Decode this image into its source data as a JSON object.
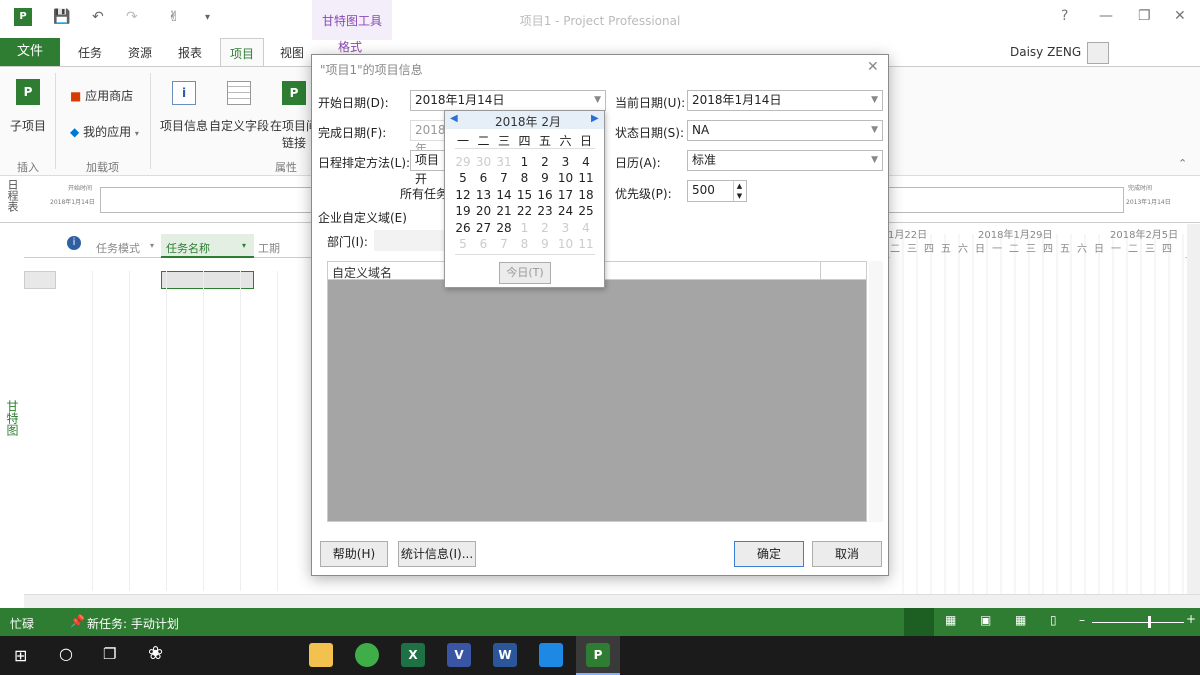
{
  "window": {
    "app_title": "项目1 - Project Professional",
    "contextual_tab": "甘特图工具",
    "contextual_subtab": "格式",
    "user_name": "Daisy ZENG",
    "help": "?"
  },
  "ribbon": {
    "file_tab": "文件",
    "tabs": [
      "任务",
      "资源",
      "报表",
      "项目",
      "视图"
    ],
    "active_tab": "项目",
    "buttons": {
      "subproject": "子项目",
      "app_store": "应用商店",
      "my_apps": "我的应用",
      "project_info": "项目信息",
      "custom_fields": "自定义字段",
      "links_line1": "在项目间",
      "links_line2": "链接"
    },
    "groups": {
      "insert": "插入",
      "addins": "加载项",
      "properties": "属性"
    }
  },
  "timeline": {
    "side_label": "日程表",
    "start_label": "开始时间",
    "start_date": "2018年1月14日",
    "end_label": "完成时间",
    "end_date": "2013年1月14日"
  },
  "sheet": {
    "columns": [
      "任务模式",
      "任务名称",
      "工期"
    ],
    "side_label": "甘特图",
    "gantt_dates": [
      "1月22日",
      "2018年1月29日",
      "2018年2月5日"
    ],
    "weekdays": [
      "二",
      "三",
      "四",
      "五",
      "六",
      "日",
      "一",
      "二",
      "三",
      "四",
      "五",
      "六",
      "日",
      "一",
      "二",
      "三",
      "四"
    ]
  },
  "dialog": {
    "title": "\"项目1\"的项目信息",
    "start_date_label": "开始日期(D):",
    "start_date_value": "2018年1月14日",
    "finish_date_label": "完成日期(F):",
    "finish_date_value": "2018年",
    "schedule_from_label": "日程排定方法(L):",
    "schedule_from_value": "项目开",
    "all_tasks_text": "所有任务",
    "current_date_label": "当前日期(U):",
    "current_date_value": "2018年1月14日",
    "status_date_label": "状态日期(S):",
    "status_date_value": "NA",
    "calendar_label": "日历(A):",
    "calendar_value": "标准",
    "priority_label": "优先级(P):",
    "priority_value": "500",
    "enterprise_label": "企业自定义域(E)",
    "department_label": "部门(I):",
    "custom_field_header": "自定义域名",
    "help_button": "帮助(H)",
    "statistics_button": "统计信息(I)...",
    "ok_button": "确定",
    "cancel_button": "取消"
  },
  "calendar": {
    "month_label": "2018年 2月",
    "weekdays": [
      "一",
      "二",
      "三",
      "四",
      "五",
      "六",
      "日"
    ],
    "weeks": [
      [
        "29",
        "30",
        "31",
        "1",
        "2",
        "3",
        "4"
      ],
      [
        "5",
        "6",
        "7",
        "8",
        "9",
        "10",
        "11"
      ],
      [
        "12",
        "13",
        "14",
        "15",
        "16",
        "17",
        "18"
      ],
      [
        "19",
        "20",
        "21",
        "22",
        "23",
        "24",
        "25"
      ],
      [
        "26",
        "27",
        "28",
        "1",
        "2",
        "3",
        "4"
      ],
      [
        "5",
        "6",
        "7",
        "8",
        "9",
        "10",
        "11"
      ]
    ],
    "today_button": "今日(T)"
  },
  "status_bar": {
    "ready": "忙碌",
    "new_tasks": "新任务: 手动计划"
  },
  "colors": {
    "accent": "#2e7d32",
    "contextual": "#8a49b3",
    "calendar_header": "#e6eef8"
  }
}
